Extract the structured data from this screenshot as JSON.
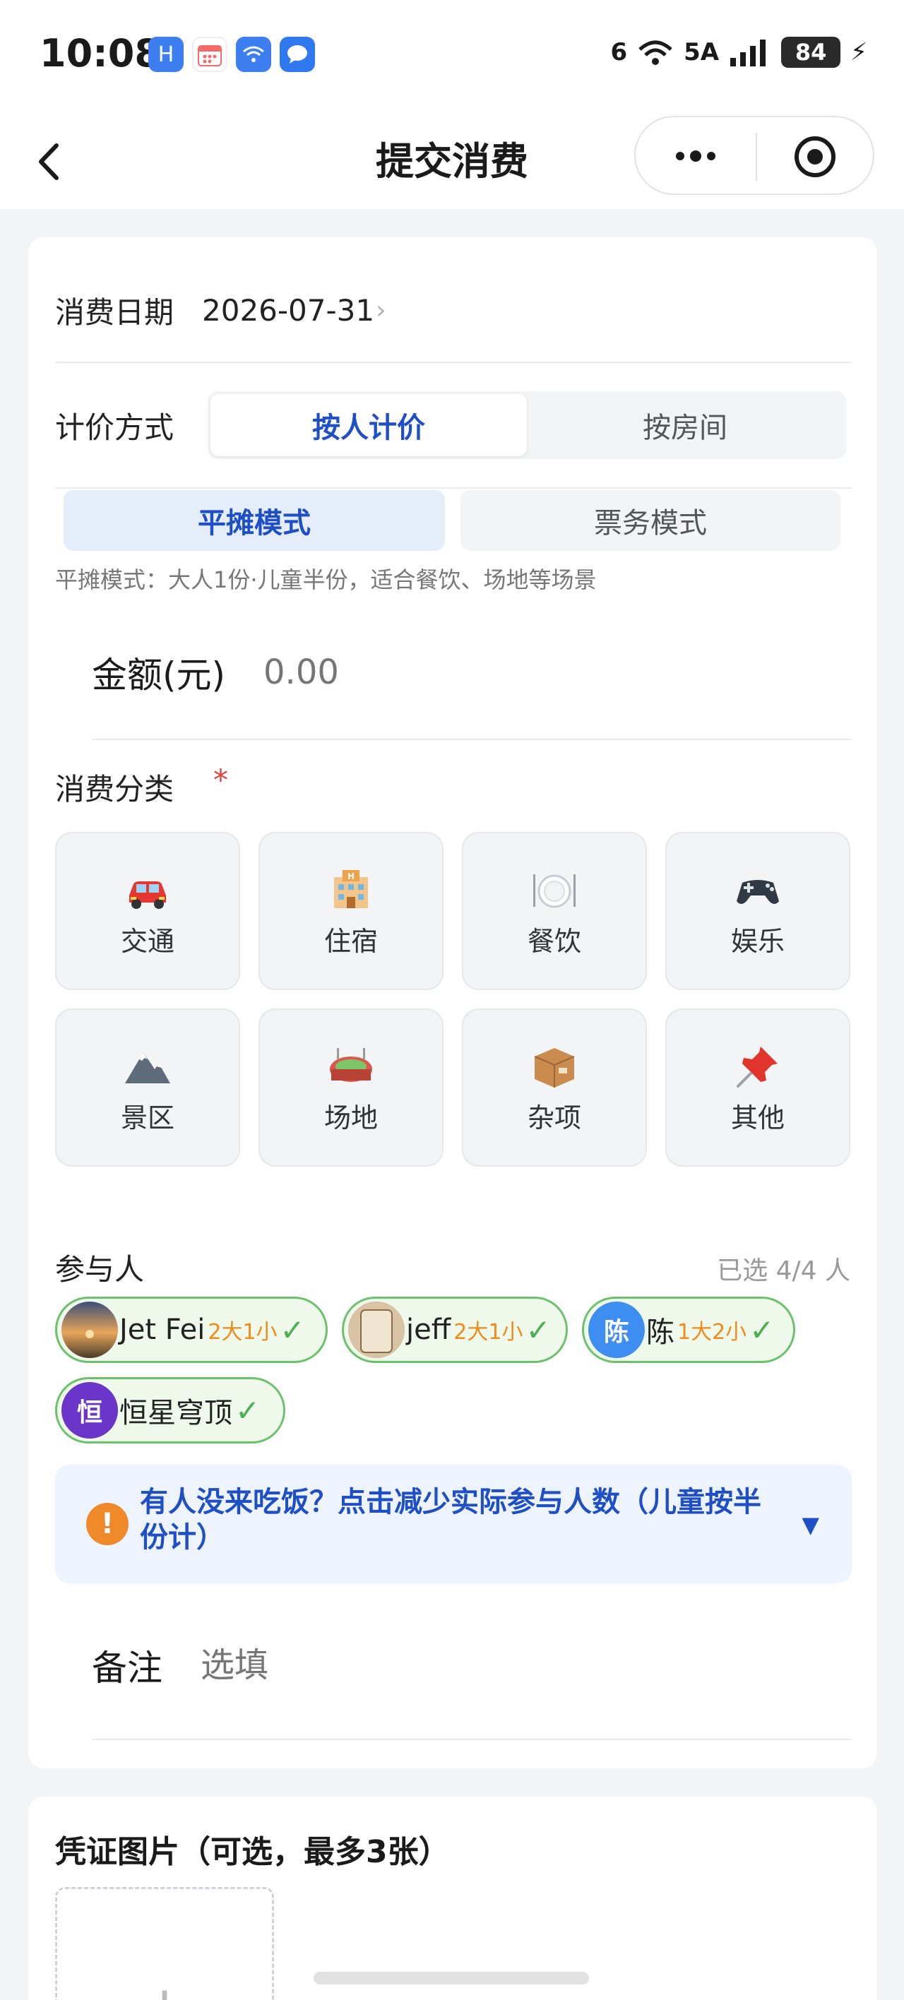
{
  "status_bar": {
    "time": "10:08",
    "network_1": "6",
    "network_2": "5A",
    "battery": "84"
  },
  "nav": {
    "title": "提交消费"
  },
  "form": {
    "date_label": "消费日期",
    "date_value": "2026-07-31",
    "pricing_label": "计价方式",
    "pricing_options": [
      "按人计价",
      "按房间"
    ],
    "pricing_selected": "按人计价",
    "modes": [
      "平摊模式",
      "票务模式"
    ],
    "mode_selected": "平摊模式",
    "mode_desc": "平摊模式：大人1份·儿童半份，适合餐饮、场地等场景",
    "amount_label": "金额(元)",
    "amount_placeholder": "0.00",
    "category_label": "消费分类",
    "required_mark": "*",
    "categories": [
      {
        "label": "交通",
        "icon": "car-icon"
      },
      {
        "label": "住宿",
        "icon": "hotel-icon"
      },
      {
        "label": "餐饮",
        "icon": "dining-icon"
      },
      {
        "label": "娱乐",
        "icon": "gamepad-icon"
      },
      {
        "label": "景区",
        "icon": "mountain-icon"
      },
      {
        "label": "场地",
        "icon": "stadium-icon"
      },
      {
        "label": "杂项",
        "icon": "package-icon"
      },
      {
        "label": "其他",
        "icon": "pushpin-icon"
      }
    ],
    "participants_label": "参与人",
    "participants_count": "已选 4/4 人",
    "participants": [
      {
        "name": "Jet Fei",
        "tag": "2大1小",
        "avatar_text": "",
        "avatar_color": "#8a6a4a"
      },
      {
        "name": "jeff",
        "tag": "2大1小",
        "avatar_text": "",
        "avatar_color": "#b59a78"
      },
      {
        "name": "陈",
        "tag": "1大2小",
        "avatar_text": "陈",
        "avatar_color": "#3d8ef0"
      },
      {
        "name": "恒星穹顶",
        "tag": "",
        "avatar_text": "恒",
        "avatar_color": "#6a35c8"
      }
    ],
    "check_mark": "✓",
    "tip_text": "有人没来吃饭？点击减少实际参与人数（儿童按半份计）",
    "tip_arrow": "▼",
    "note_label": "备注",
    "note_placeholder": "选填"
  },
  "voucher": {
    "title": "凭证图片（可选，最多3张）",
    "upload_plus": "+"
  },
  "colors": {
    "accent": "#1f4fc6",
    "chip_border": "#6cc26c",
    "tag": "#f08a18",
    "warning": "#f0892a"
  }
}
